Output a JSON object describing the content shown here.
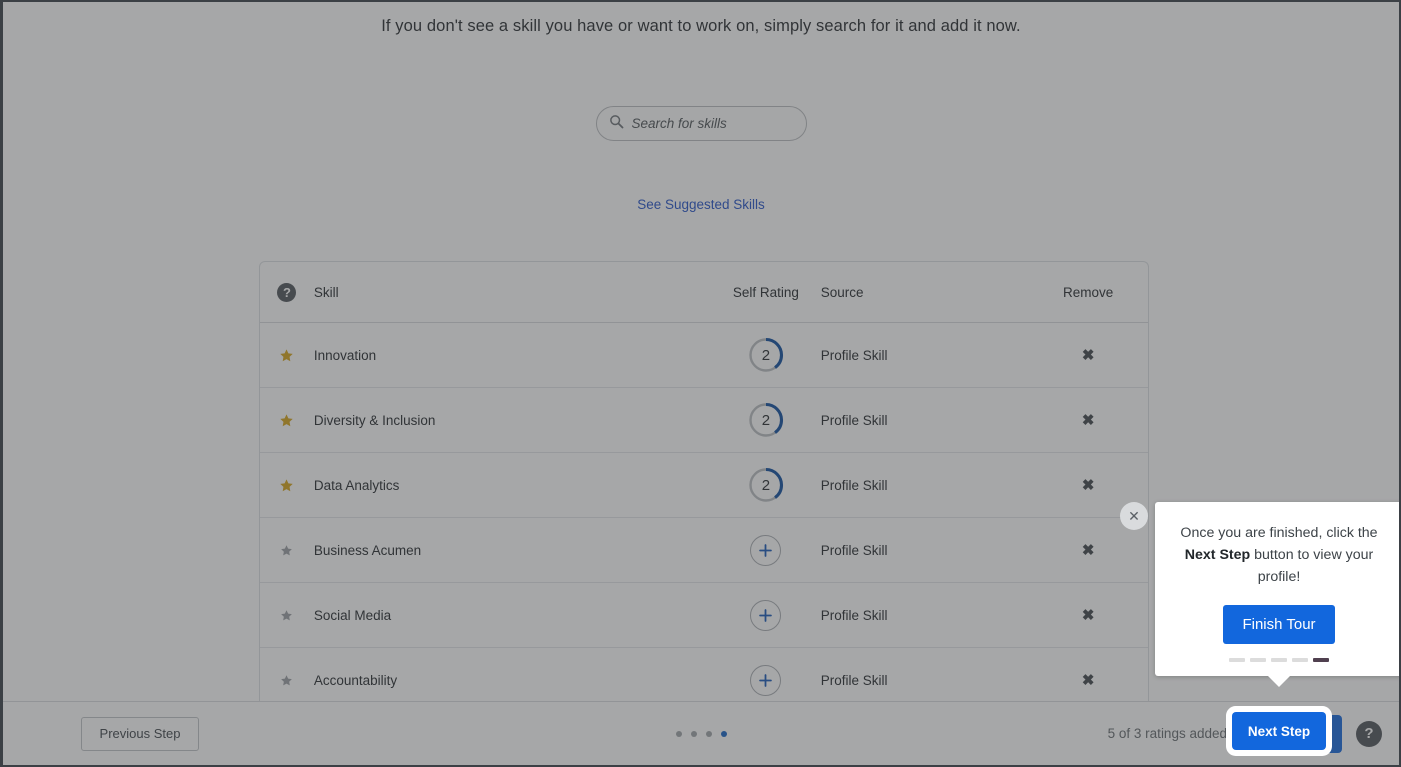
{
  "page": {
    "intro_text": "If you don't see a skill you have or want to work on, simply search for it and add it now.",
    "suggested_link": "See Suggested Skills"
  },
  "search": {
    "placeholder": "Search for skills",
    "value": "",
    "icon": "search-icon"
  },
  "table": {
    "help_icon": "question-mark-icon",
    "columns": [
      "Skill",
      "Self Rating",
      "Source",
      "Remove"
    ],
    "rows": [
      {
        "skill": "Innovation",
        "starred": true,
        "rating": "2",
        "rating_value": 2,
        "source": "Profile Skill",
        "remove": "✖"
      },
      {
        "skill": "Diversity & Inclusion",
        "starred": true,
        "rating": "2",
        "rating_value": 2,
        "source": "Profile Skill",
        "remove": "✖"
      },
      {
        "skill": "Data Analytics",
        "starred": true,
        "rating": "2",
        "rating_value": 2,
        "source": "Profile Skill",
        "remove": "✖"
      },
      {
        "skill": "Business Acumen",
        "starred": false,
        "rating": "+",
        "rating_value": 0,
        "source": "Profile Skill",
        "remove": "✖"
      },
      {
        "skill": "Social Media",
        "starred": false,
        "rating": "+",
        "rating_value": 0,
        "source": "Profile Skill",
        "remove": "✖"
      },
      {
        "skill": "Accountability",
        "starred": false,
        "rating": "+",
        "rating_value": 0,
        "source": "Profile Skill",
        "remove": "✖"
      }
    ]
  },
  "footer": {
    "previous_label": "Previous Step",
    "next_label": "Next Step",
    "ratings_status": "5 of 3 ratings added",
    "help_label": "?",
    "step_dots": 4,
    "step_active_index": 3
  },
  "tour": {
    "text_before": "Once you are finished, click the ",
    "text_bold": "Next Step",
    "text_after": " button to view your profile!",
    "finish_label": "Finish Tour",
    "close_label": "✕",
    "progress_total": 5,
    "progress_active_index": 4
  },
  "colors": {
    "primary_blue": "#1267dd",
    "link_blue": "#2050c8",
    "star_gold": "#d6a215",
    "star_grey": "#9a9ea2",
    "rating_arc": "#0b4b9e",
    "scrim": "rgba(65,68,71,0.47)",
    "tour_progress_active": "#50404f"
  }
}
